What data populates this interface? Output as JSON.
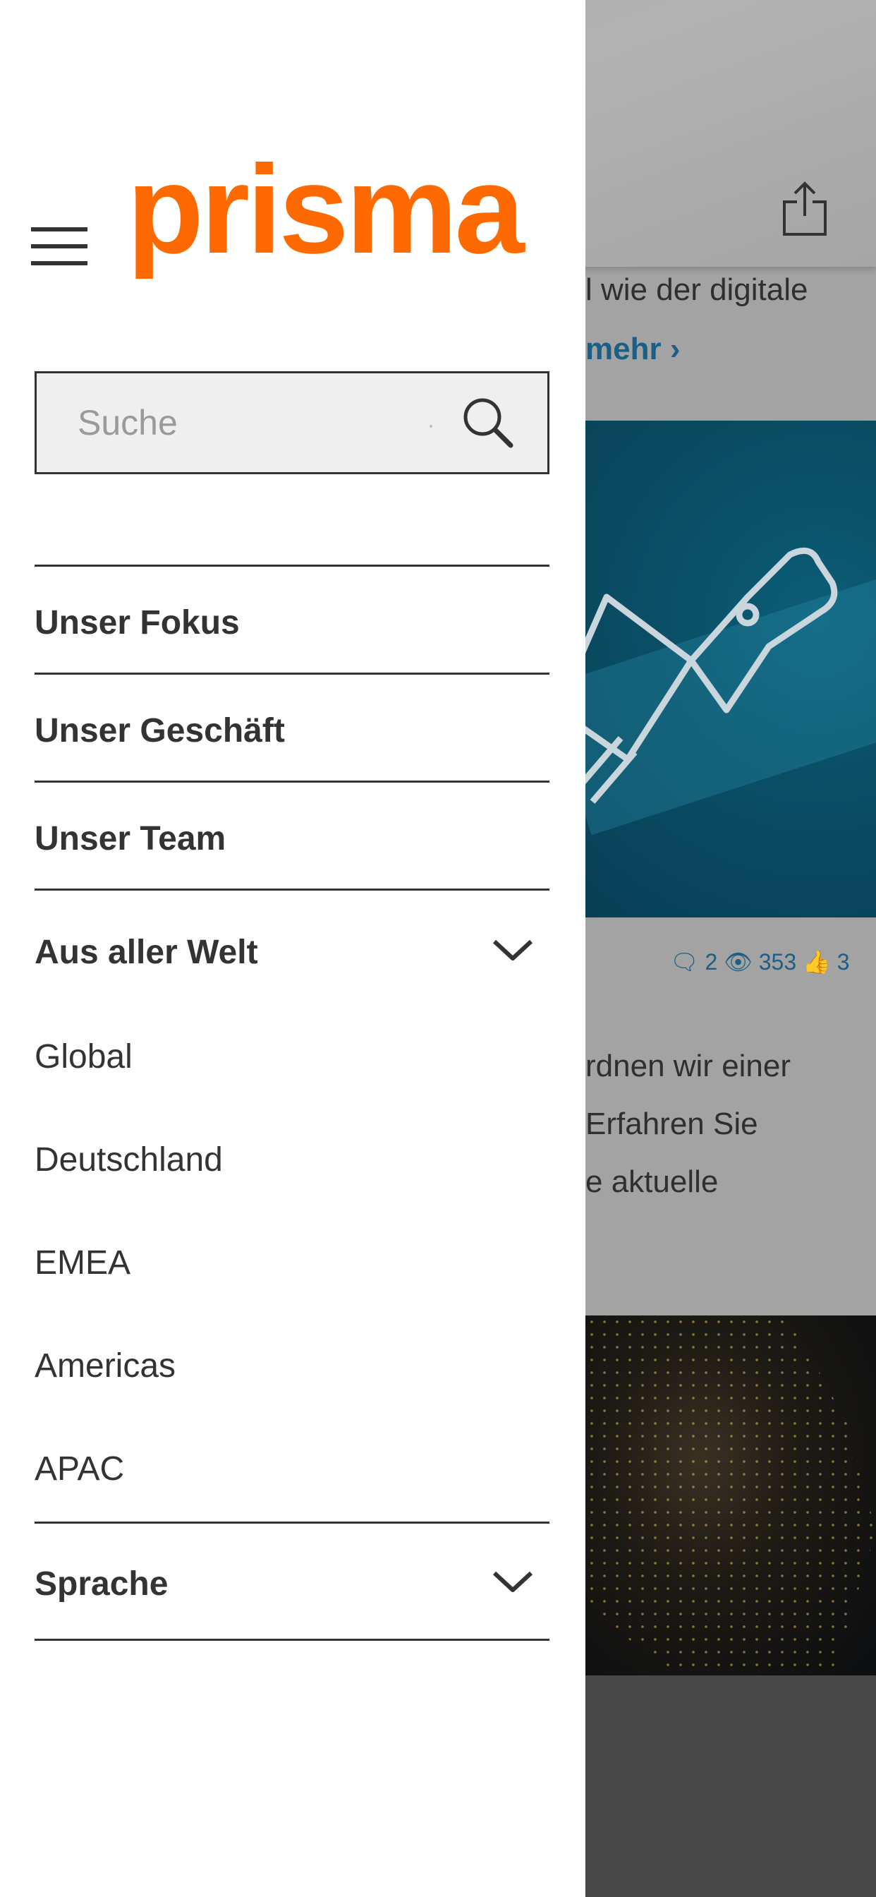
{
  "app": {
    "logo_text": "prisma",
    "brand_color": "#ff6a00"
  },
  "search": {
    "placeholder": "Suche"
  },
  "menu": {
    "items": [
      {
        "label": "Unser Fokus"
      },
      {
        "label": "Unser Geschäft"
      },
      {
        "label": "Unser Team"
      },
      {
        "label": "Aus aller Welt",
        "expanded": true,
        "children": [
          "Global",
          "Deutschland",
          "EMEA",
          "Americas",
          "APAC"
        ]
      },
      {
        "label": "Sprache",
        "expanded": false
      }
    ]
  },
  "background": {
    "article_text_1": "l wie der digitale",
    "read_more": "mehr ›",
    "stats": {
      "comments": "2",
      "views": "353",
      "likes": "3"
    },
    "article2_lines": [
      "rdnen wir einer",
      "Erfahren Sie",
      "e aktuelle"
    ]
  },
  "icons": {
    "menu": "hamburger-icon",
    "search": "search-icon",
    "share": "share-icon",
    "expand": "chevron-down-icon",
    "comments": "comment-icon",
    "views": "eye-icon",
    "likes": "thumbs-up-icon"
  }
}
